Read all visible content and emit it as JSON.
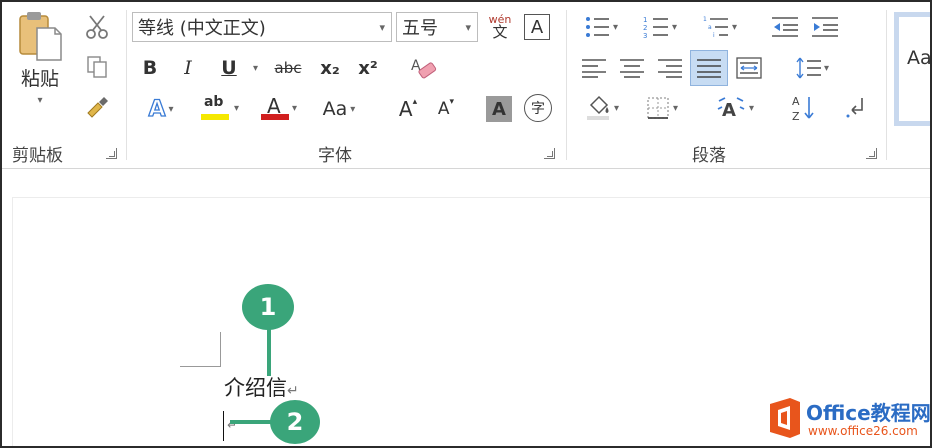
{
  "clipboard": {
    "paste_label": "粘贴",
    "group_label": "剪贴板"
  },
  "font": {
    "font_name": "等线 (中文正文)",
    "font_size": "五号",
    "bold": "B",
    "italic": "I",
    "underline": "U",
    "strikethrough": "abc",
    "subscript": "x₂",
    "superscript": "x²",
    "phonetic_top": "wén",
    "phonetic_bottom": "文",
    "border_char": "A",
    "text_effect": "A",
    "highlight": "ab",
    "font_color": "A",
    "change_case": "Aa",
    "grow_font": "A",
    "shrink_font": "A",
    "shading_char": "A",
    "enclose_char": "字",
    "group_label": "字体"
  },
  "paragraph": {
    "group_label": "段落",
    "sort": "A↓"
  },
  "styles": {
    "preview": "Aa"
  },
  "document": {
    "line1": "介绍信",
    "para_mark": "↵"
  },
  "callouts": [
    "1",
    "2"
  ],
  "watermark": {
    "brand": "Office教程网",
    "url": "www.office26.com"
  },
  "colors": {
    "callout": "#3aa57a",
    "font_color_bar": "#d11f1f",
    "highlight_bar": "#f5e800",
    "selected_button": "#c7dcf3"
  }
}
